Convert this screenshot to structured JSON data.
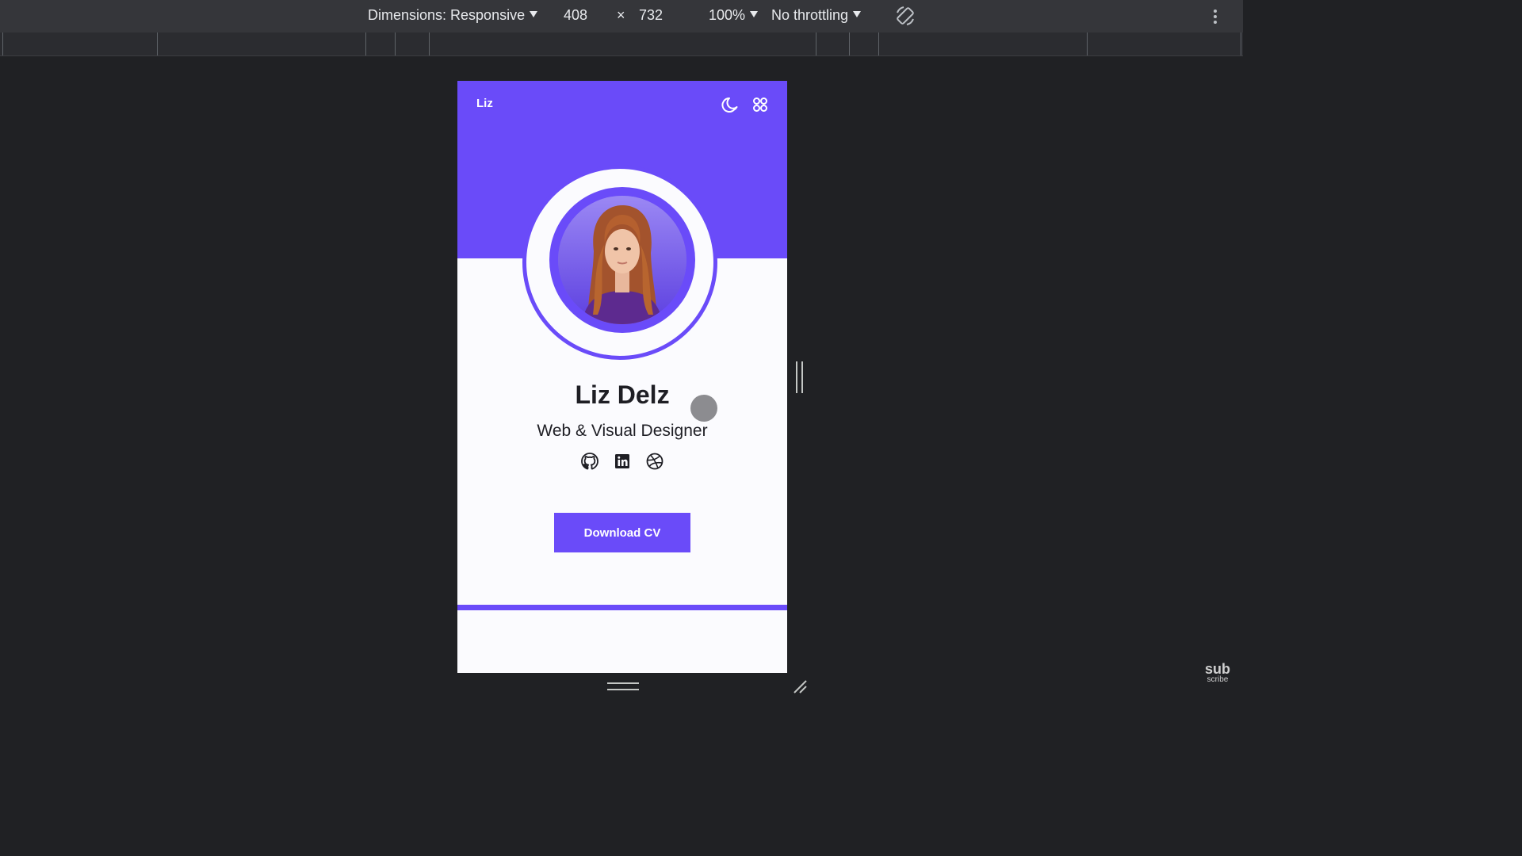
{
  "devtools": {
    "dimensions_label": "Dimensions: Responsive",
    "width": "408",
    "times": "×",
    "height": "732",
    "zoom": "100%",
    "throttling": "No throttling",
    "rotate_icon": "rotate-icon",
    "menu_icon": "kebab-menu-icon"
  },
  "site": {
    "logo": "Liz",
    "theme_icon": "moon-icon",
    "apps_icon": "grid-icon",
    "name": "Liz Delz",
    "role": "Web & Visual Designer",
    "socials": [
      "github-icon",
      "linkedin-icon",
      "dribbble-icon"
    ],
    "cta_label": "Download CV",
    "accent": "#6a4bf9",
    "background": "#fbfbfe"
  },
  "watermark": {
    "line1": "sub",
    "line2": "scribe"
  }
}
